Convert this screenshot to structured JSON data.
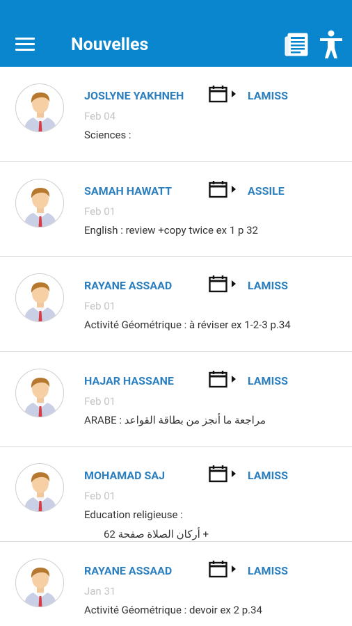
{
  "header": {
    "title": "Nouvelles",
    "menu_icon": "menu-icon",
    "news_icon": "newspaper-icon",
    "accessibility_icon": "accessibility-icon",
    "background": "#0a86cf"
  },
  "feed": {
    "items": [
      {
        "sender": "JOSLYNE YAKHNEH",
        "class": "LAMISS",
        "date": "Feb 04",
        "body": [
          "Sciences :"
        ]
      },
      {
        "sender": "SAMAH HAWATT",
        "class": "ASSILE",
        "date": "Feb 01",
        "body": [
          "English : review +copy twice ex 1 p 32"
        ]
      },
      {
        "sender": "RAYANE ASSAAD",
        "class": "LAMISS",
        "date": "Feb 01",
        "body": [
          "Activité Géométrique : à réviser ex 1-2-3 p.34"
        ]
      },
      {
        "sender": "HAJAR HASSANE",
        "class": "LAMISS",
        "date": "Feb 01",
        "body": [
          "ARABE : مراجعة ما أنجز من بطاقة القواعد"
        ]
      },
      {
        "sender": "MOHAMAD SAJ",
        "class": "LAMISS",
        "date": "Feb 01",
        "body": [
          "Education religieuse :",
          "+ أركان الصلاة صفحة 62"
        ]
      },
      {
        "sender": "RAYANE ASSAAD",
        "class": "LAMISS",
        "date": "Jan 31",
        "body": [
          "Activité Géométrique : devoir ex 2 p.34"
        ]
      }
    ]
  }
}
